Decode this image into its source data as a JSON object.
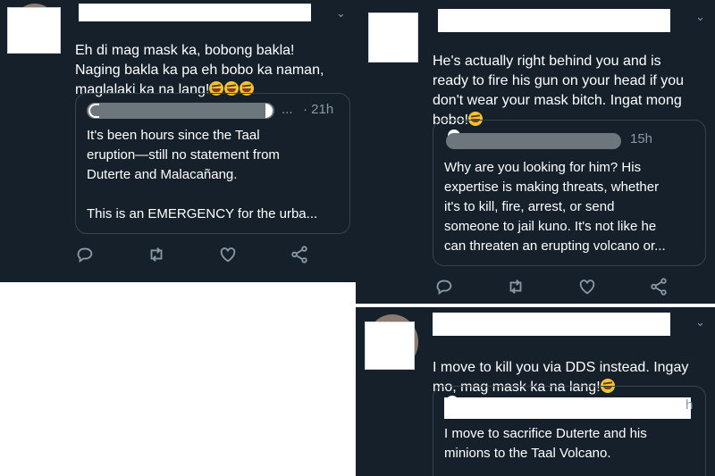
{
  "tweets": [
    {
      "text": "Eh di mag mask ka, bobong bakla!\nNaging bakla ka pa eh bobo ka naman,\nmaglalaki ka na lang!",
      "emoji_count": 3,
      "quote": {
        "ellipsis": "...",
        "time": "· 21h",
        "text": "It's been hours since the Taal\neruption—still no statement from\nDuterte and Malacañang.\n\nThis is an EMERGENCY for the urba..."
      }
    },
    {
      "text": "He's actually right behind you and is\nready to fire his gun on your head if you\ndon't wear your mask bitch. Ingat mong\nbobo!",
      "emoji_count": 1,
      "quote": {
        "time": "15h",
        "text": "Why are you looking for him? His\nexpertise is making threats, whether\nit's to kill, fire, arrest, or send\nsomeone to jail kuno. It's not like he\ncan threaten an erupting volcano or..."
      }
    },
    {
      "text": "I move to kill you via DDS instead. Ingay\nmo, mag mask ka na lang!",
      "emoji_count": 1,
      "quote": {
        "time": "h",
        "text": "I move to sacrifice Duterte and his\nminions to the Taal Volcano."
      }
    }
  ],
  "icons": {
    "chevron": "chevron-down-icon",
    "reply": "reply-icon",
    "retweet": "retweet-icon",
    "like": "heart-icon",
    "share": "share-icon"
  },
  "colors": {
    "background": "#15202b",
    "border": "#38444d",
    "secondary_text": "#8899a6",
    "redaction": "#ffffff"
  }
}
